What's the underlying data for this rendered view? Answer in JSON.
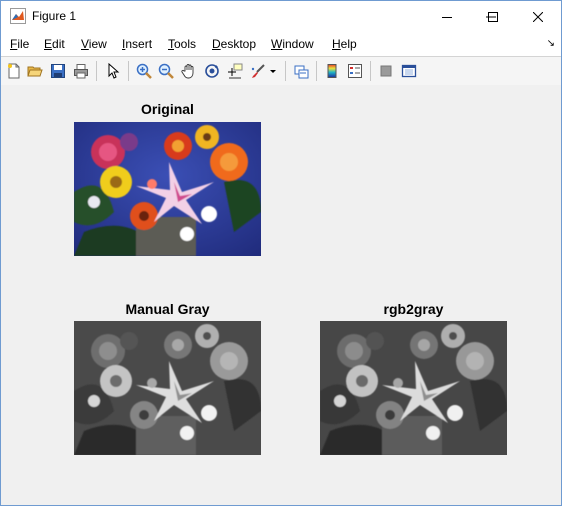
{
  "window": {
    "title": "Figure 1"
  },
  "menus": [
    {
      "pre": "",
      "u": "F",
      "post": "ile"
    },
    {
      "pre": "",
      "u": "E",
      "post": "dit"
    },
    {
      "pre": "",
      "u": "V",
      "post": "iew"
    },
    {
      "pre": "",
      "u": "I",
      "post": "nsert"
    },
    {
      "pre": "",
      "u": "T",
      "post": "ools"
    },
    {
      "pre": "",
      "u": "D",
      "post": "esktop"
    },
    {
      "pre": "",
      "u": "W",
      "post": "indow"
    },
    {
      "pre": "",
      "u": "H",
      "post": "elp"
    }
  ],
  "toolbar": {
    "icons": [
      "new-figure-icon",
      "open-file-icon",
      "save-icon",
      "print-icon",
      "pointer-icon",
      "zoom-in-icon",
      "zoom-out-icon",
      "pan-icon",
      "rotate-3d-icon",
      "data-cursor-icon",
      "brush-icon",
      "link-plot-icon",
      "colorbar-icon",
      "legend-icon",
      "hide-plot-tools-icon",
      "show-plot-tools-icon"
    ]
  },
  "axes": {
    "original": {
      "title": "Original"
    },
    "manual": {
      "title": "Manual Gray"
    },
    "rgb2gray": {
      "title": "rgb2gray"
    }
  }
}
